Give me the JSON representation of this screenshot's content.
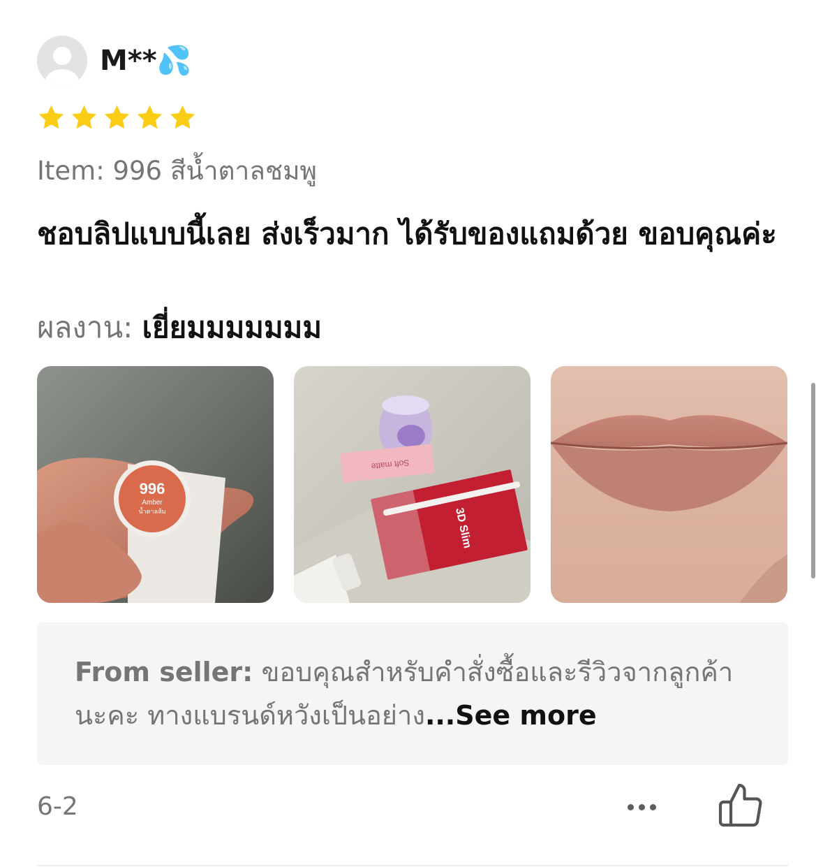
{
  "reviewer": {
    "name": "M**💦",
    "avatar_icon": "default-user-avatar-icon"
  },
  "rating": {
    "value": 5,
    "max": 5,
    "star_color": "#FACC15"
  },
  "item": {
    "label": "Item:",
    "variant": "996 สีน้ำตาลชมพู"
  },
  "review": {
    "text": "ชอบลิปแบบนี้เลย ส่งเร็วมาก ได้รับของแถมด้วย ขอบคุณค่ะ",
    "result_label": "ผลงาน:",
    "result_value": "เยี่ยมมมมมมม"
  },
  "photos": [
    {
      "name": "lipstick-shade-photo",
      "label_number": "996",
      "label_name": "Amber",
      "label_thai": "น้ำตาลส้ม"
    },
    {
      "name": "gift-items-photo",
      "label_box1": "Soft matte",
      "label_box2": "3D Slim"
    },
    {
      "name": "lip-swatch-photo"
    }
  ],
  "seller_reply": {
    "label": "From seller:",
    "text": " ขอบคุณสำหรับคำสั่งซื้อและรีวิวจากลูกค้านะคะ ทางแบรนด์หวังเป็นอย่าง",
    "see_more": "...See more"
  },
  "footer": {
    "date": "6-2",
    "more_icon": "more-horizontal-icon",
    "like_icon": "thumbs-up-icon"
  }
}
